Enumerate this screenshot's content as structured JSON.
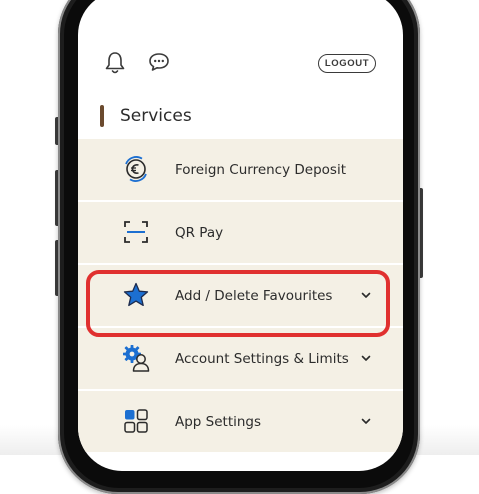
{
  "header": {
    "notification_icon": "bell-icon",
    "chat_icon": "chat-bubble-icon",
    "logout_label": "LOGOUT"
  },
  "section": {
    "title": "Services"
  },
  "menu": {
    "items": [
      {
        "label": "Foreign Currency Deposit",
        "icon": "currency-exchange-icon",
        "expandable": false
      },
      {
        "label": "QR Pay",
        "icon": "qr-scan-icon",
        "expandable": false
      },
      {
        "label": "Add / Delete Favourites",
        "icon": "star-icon",
        "expandable": true
      },
      {
        "label": "Account Settings & Limits",
        "icon": "user-settings-icon",
        "expandable": true
      },
      {
        "label": "App Settings",
        "icon": "grid-icon",
        "expandable": true
      }
    ]
  },
  "colors": {
    "accent_blue": "#1c6fd1",
    "row_background": "#f4f0e5",
    "section_bar": "#6b4a2e",
    "highlight": "#e0302f"
  }
}
